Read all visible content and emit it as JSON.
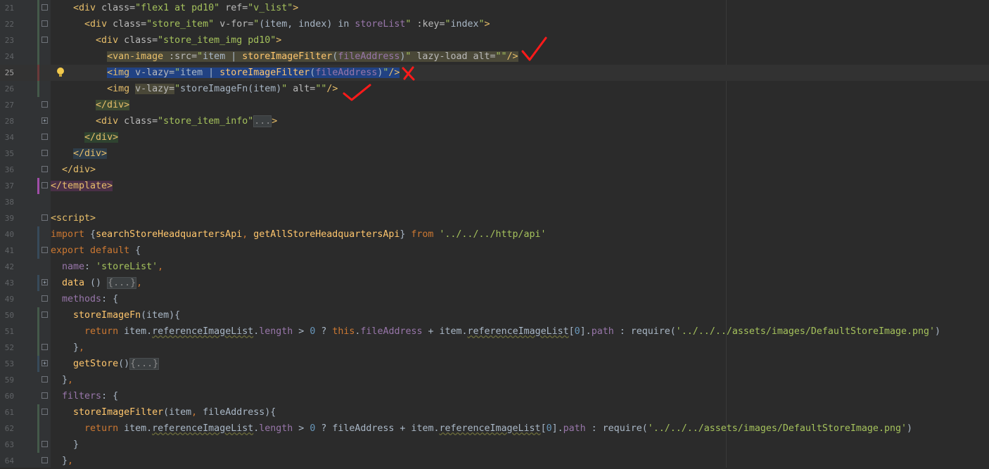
{
  "editor": {
    "gutter": {
      "line_numbers": [
        "21",
        "22",
        "23",
        "24",
        "25",
        "26",
        "27",
        "28",
        "34",
        "35",
        "36",
        "37",
        "38",
        "39",
        "40",
        "41",
        "42",
        "43",
        "49",
        "50",
        "51",
        "52",
        "53",
        "59",
        "60",
        "61",
        "62",
        "63",
        "64"
      ],
      "current_line": "25"
    },
    "colors": {
      "background": "#2b2b2b",
      "tag": "#e8bf6a",
      "string": "#a5c25c",
      "keyword": "#cc7832",
      "field": "#9876aa",
      "function": "#ffc66d",
      "number": "#6897bb",
      "selection": "#214283",
      "annotation_red": "#ff0000"
    },
    "icons": {
      "intention": "lightbulb-icon",
      "fold": "fold-toggle-icon",
      "check": "red-checkmark-annotation",
      "cross": "red-x-annotation"
    },
    "lines": [
      {
        "n": "21",
        "text": "    <div class=\"flex1 at pd10\" ref=\"v_list\">"
      },
      {
        "n": "22",
        "text": "      <div class=\"store_item\" v-for=\"(item, index) in storeList\" :key=\"index\">"
      },
      {
        "n": "23",
        "text": "        <div class=\"store_item_img pd10\">"
      },
      {
        "n": "24",
        "text": "          <van-image :src=\"item | storeImageFilter(fileAddress)\" lazy-load alt=\"\"/>"
      },
      {
        "n": "25",
        "text": "          <img v-lazy=\"item | storeImageFilter(fileAddress)\"/>"
      },
      {
        "n": "26",
        "text": "          <img v-lazy=\"storeImageFn(item)\" alt=\"\"/>"
      },
      {
        "n": "27",
        "text": "        </div>"
      },
      {
        "n": "28",
        "text": "        <div class=\"store_item_info\"...>"
      },
      {
        "n": "34",
        "text": "      </div>"
      },
      {
        "n": "35",
        "text": "    </div>"
      },
      {
        "n": "36",
        "text": "  </div>"
      },
      {
        "n": "37",
        "text": "</template>"
      },
      {
        "n": "38",
        "text": ""
      },
      {
        "n": "39",
        "text": "<script>"
      },
      {
        "n": "40",
        "text": "import {searchStoreHeadquartersApi, getAllStoreHeadquartersApi} from '../../../http/api'"
      },
      {
        "n": "41",
        "text": "export default {"
      },
      {
        "n": "42",
        "text": "  name: 'storeList',"
      },
      {
        "n": "43",
        "text": "  data () {...},"
      },
      {
        "n": "49",
        "text": "  methods: {"
      },
      {
        "n": "50",
        "text": "    storeImageFn(item){"
      },
      {
        "n": "51",
        "text": "      return item.referenceImageList.length > 0 ? this.fileAddress + item.referenceImageList[0].path : require('../../../assets/images/DefaultStoreImage.png')"
      },
      {
        "n": "52",
        "text": "    },"
      },
      {
        "n": "53",
        "text": "    getStore(){...}"
      },
      {
        "n": "59",
        "text": "  },"
      },
      {
        "n": "60",
        "text": "  filters: {"
      },
      {
        "n": "61",
        "text": "    storeImageFilter(item, fileAddress){"
      },
      {
        "n": "62",
        "text": "      return item.referenceImageList.length > 0 ? fileAddress + item.referenceImageList[0].path : require('../../../assets/images/DefaultStoreImage.png')"
      },
      {
        "n": "63",
        "text": "    }"
      },
      {
        "n": "64",
        "text": "  },"
      }
    ]
  }
}
